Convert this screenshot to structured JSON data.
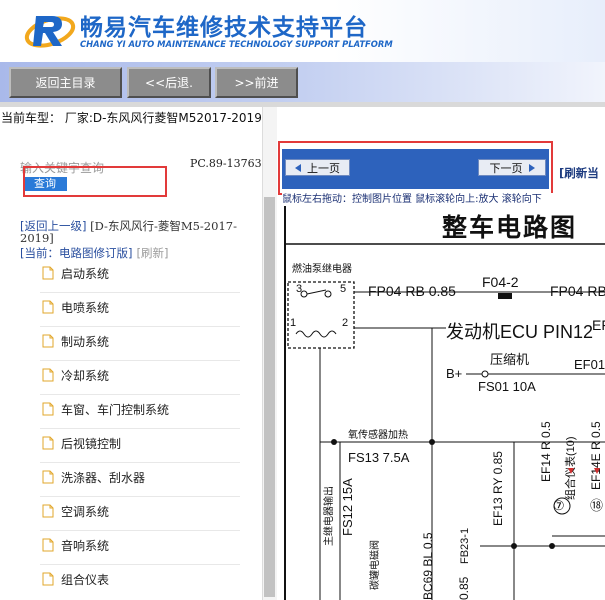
{
  "brand": {
    "title": "畅易汽车维修技术支持平台",
    "subtitle": "CHANG YI AUTO MAINTENANCE TECHNOLOGY SUPPORT PLATFORM"
  },
  "toolbar": {
    "home_label": "返回主目录",
    "back_label": "<<后退.",
    "forward_label": ">>前进"
  },
  "model_bar": {
    "text": "当前车型： 厂家:D-东风风行菱智M52017-2019"
  },
  "sidebar": {
    "search_placeholder": "输入关键字查询",
    "search_button": "查询",
    "code": "PC.89-13763",
    "up_link": "[返回上一级]",
    "path_text": "[D-东风风行-菱智M5-2017-2019]",
    "current": "[当前：电路图修订版]",
    "refresh": "[刷新]",
    "items": [
      {
        "label": "启动系统"
      },
      {
        "label": "电喷系统"
      },
      {
        "label": "制动系统"
      },
      {
        "label": "冷却系统"
      },
      {
        "label": "车窗、车门控制系统"
      },
      {
        "label": "后视镜控制"
      },
      {
        "label": "洗涤器、刮水器"
      },
      {
        "label": "空调系统"
      },
      {
        "label": "音响系统"
      },
      {
        "label": "组合仪表"
      }
    ]
  },
  "viewer": {
    "prev_label": "上一页",
    "next_label": "下一页",
    "refresh_label": "[刷新当",
    "hint": "鼠标左右拖动：控制图片位置  鼠标滚轮向上:放大  滚轮向下",
    "diagram_title": "整车电路图",
    "labels": {
      "relay": "燃油泵继电器",
      "fp04_left": "FP04 RB 0.85",
      "f04_2": "F04-2",
      "fp04_right": "FP04 RB",
      "ecu": "发动机ECU PIN12",
      "ef": "EF",
      "compressor": "压缩机",
      "bplus": "B+",
      "fs01": "FS01 10A",
      "ef01": "EF01",
      "o2": "氧传感器加热",
      "fs13": "FS13 7.5A",
      "fs12": "FS12 15A",
      "main_relay": "主继电器输出",
      "ef13": "EF13 RY 0.85",
      "ef14r": "EF14 R 0.5",
      "cluster1": "组合仪表(10)",
      "ef14e": "EF14E R 0.5",
      "cluster2": "组合仪表",
      "n7": "⑦",
      "n18": "⑱",
      "fb23": "FB23-1",
      "c69": "BC69 BL 0.5",
      "n085": "0.85",
      "mid_vert": "碳罐电磁阀"
    }
  },
  "colors": {
    "brand_blue": "#1e67c7",
    "toolbar_button": "#8c8c8c",
    "nav_bar": "#2d62bc",
    "highlight_red": "#e23a3a",
    "search_button": "#2a7ad8"
  }
}
